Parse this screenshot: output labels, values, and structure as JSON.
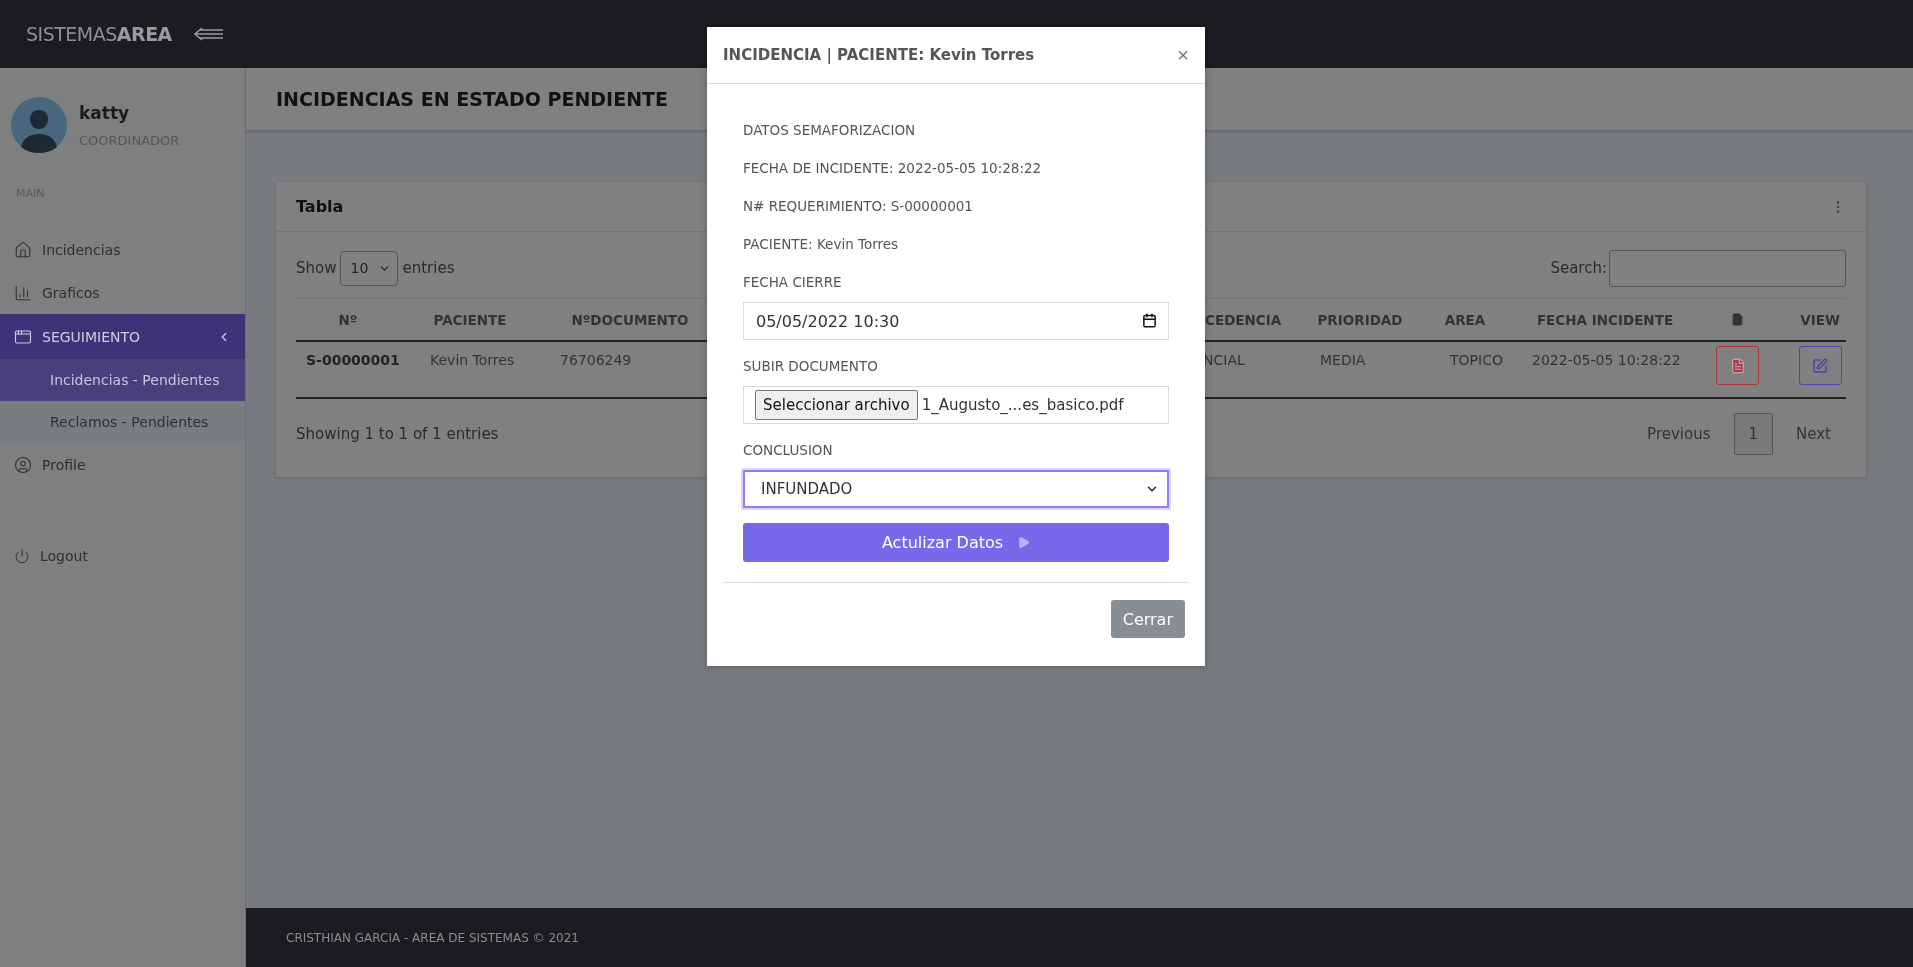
{
  "app": {
    "logo_light": "SISTEMAS",
    "logo_bold": "AREA"
  },
  "user": {
    "name": "katty",
    "role": "COORDINADOR"
  },
  "sidebar": {
    "section": "MAIN",
    "items": [
      {
        "label": "Incidencias",
        "selected": false
      },
      {
        "label": "Graficos",
        "selected": false
      },
      {
        "label": "SEGUIMIENTO",
        "selected": true,
        "expanded": true,
        "children": [
          {
            "label": "Incidencias - Pendientes",
            "selected": true
          },
          {
            "label": "Reclamos - Pendientes",
            "selected": false
          }
        ]
      },
      {
        "label": "Profile",
        "selected": false
      }
    ],
    "logout": "Logout"
  },
  "page_title": "INCIDENCIAS EN ESTADO PENDIENTE",
  "card": {
    "title": "Tabla",
    "show_label": "Show",
    "page_size": "10",
    "entries_label": "entries",
    "search_label": "Search:",
    "columns": [
      {
        "label": "Nº"
      },
      {
        "label": "PACIENTE"
      },
      {
        "label": "NºDOCUMENTO"
      },
      {
        "label": "CEDENCIA"
      },
      {
        "label": "PRIORIDAD"
      },
      {
        "label": "AREA"
      },
      {
        "label": "FECHA INCIDENTE"
      },
      {
        "kind": "icon"
      },
      {
        "label": "VIEW"
      }
    ],
    "rows": [
      {
        "cells": [
          "S-00000001",
          "Kevin Torres",
          "76706249",
          "NCIAL",
          "MEDIA",
          "TOPICO",
          "2022-05-05 10:28:22"
        ],
        "actions": [
          {
            "kind": "pdf"
          },
          {
            "kind": "edit"
          }
        ]
      }
    ],
    "info": "Showing 1 to 1 of 1 entries",
    "pagination": [
      {
        "label": "Previous",
        "selected": false
      },
      {
        "label": "1",
        "selected": true
      },
      {
        "label": "Next",
        "selected": false
      }
    ]
  },
  "footer": "CRISTHIAN GARCIA - AREA DE SISTEMAS © 2021",
  "modal": {
    "title": "INCIDENCIA | PACIENTE: Kevin Torres",
    "close": "×",
    "lines": [
      "DATOS SEMAFORIZACION",
      "FECHA DE INCIDENTE: 2022-05-05 10:28:22",
      "N# REQUERIMIENTO: S-00000001",
      "PACIENTE: Kevin Torres"
    ],
    "date_label": "FECHA CIERRE",
    "date_value": "05/05/2022 10:30",
    "upload_label": "SUBIR DOCUMENTO",
    "upload_button": "Seleccionar archivo",
    "upload_file": "1_Augusto_...es_basico.pdf",
    "conclusion_label": "CONCLUSION",
    "conclusion_value": "INFUNDADO",
    "submit": "Actulizar Datos",
    "dismiss": "Cerrar"
  }
}
